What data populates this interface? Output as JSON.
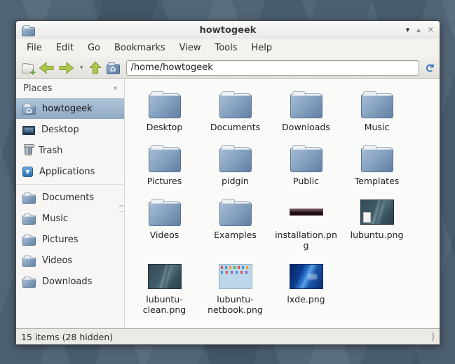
{
  "window": {
    "title": "howtogeek",
    "controls": {
      "shade": "▾",
      "maximize": "▴",
      "close": "✕"
    },
    "menu": [
      "File",
      "Edit",
      "Go",
      "Bookmarks",
      "View",
      "Tools",
      "Help"
    ],
    "toolbar": {
      "path": "/home/howtogeek"
    },
    "sidebar": {
      "header": "Places",
      "items": [
        {
          "label": "howtogeek",
          "icon": "home-folder",
          "selected": true
        },
        {
          "label": "Desktop",
          "icon": "desktop"
        },
        {
          "label": "Trash",
          "icon": "trash"
        },
        {
          "label": "Applications",
          "icon": "applications"
        },
        {
          "type": "separator"
        },
        {
          "label": "Documents",
          "icon": "folder"
        },
        {
          "label": "Music",
          "icon": "folder"
        },
        {
          "label": "Pictures",
          "icon": "folder"
        },
        {
          "label": "Videos",
          "icon": "folder"
        },
        {
          "label": "Downloads",
          "icon": "folder"
        }
      ]
    },
    "files": [
      {
        "name": "Desktop",
        "icon": "folder"
      },
      {
        "name": "Documents",
        "icon": "folder"
      },
      {
        "name": "Downloads",
        "icon": "folder"
      },
      {
        "name": "Music",
        "icon": "folder"
      },
      {
        "name": "Pictures",
        "icon": "folder"
      },
      {
        "name": "pidgin",
        "icon": "folder"
      },
      {
        "name": "Public",
        "icon": "folder"
      },
      {
        "name": "Templates",
        "icon": "folder"
      },
      {
        "name": "Videos",
        "icon": "folder"
      },
      {
        "name": "Examples",
        "icon": "folder"
      },
      {
        "name": "installation.png",
        "icon": "image-strip"
      },
      {
        "name": "lubuntu.png",
        "icon": "image-dark"
      },
      {
        "name": "lubuntu-clean.png",
        "icon": "image-dark2"
      },
      {
        "name": "lubuntu-netbook.png",
        "icon": "image-light"
      },
      {
        "name": "lxde.png",
        "icon": "image-blue"
      }
    ],
    "statusbar": {
      "text": "15 items (28 hidden)"
    }
  },
  "colors": {
    "desktop_background": "#4c6174",
    "selection": "#8ea9c4",
    "folder_blue": "#7e9cbb"
  }
}
